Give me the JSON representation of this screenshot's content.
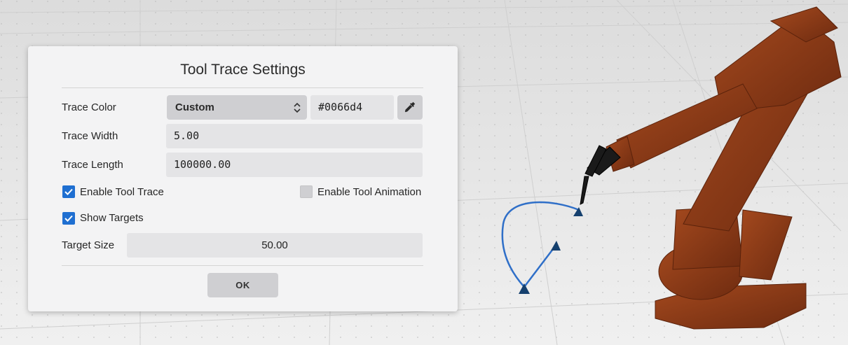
{
  "dialog": {
    "title": "Tool Trace Settings",
    "trace_color": {
      "label": "Trace Color",
      "mode": "Custom",
      "hex": "#0066d4",
      "picker_icon": "eyedropper-icon"
    },
    "trace_width": {
      "label": "Trace Width",
      "value": "5.00"
    },
    "trace_length": {
      "label": "Trace Length",
      "value": "100000.00"
    },
    "enable_tool_trace": {
      "label": "Enable Tool Trace",
      "checked": true
    },
    "enable_tool_animation": {
      "label": "Enable Tool Animation",
      "checked": false
    },
    "show_targets": {
      "label": "Show Targets",
      "checked": true
    },
    "target_size": {
      "label": "Target Size",
      "value": "50.00"
    },
    "ok_label": "OK"
  },
  "colors": {
    "accent": "#1f6fd1",
    "trace": "#2f6fc8",
    "robot": "#8b3a16",
    "floor": "#e9e9e9"
  }
}
